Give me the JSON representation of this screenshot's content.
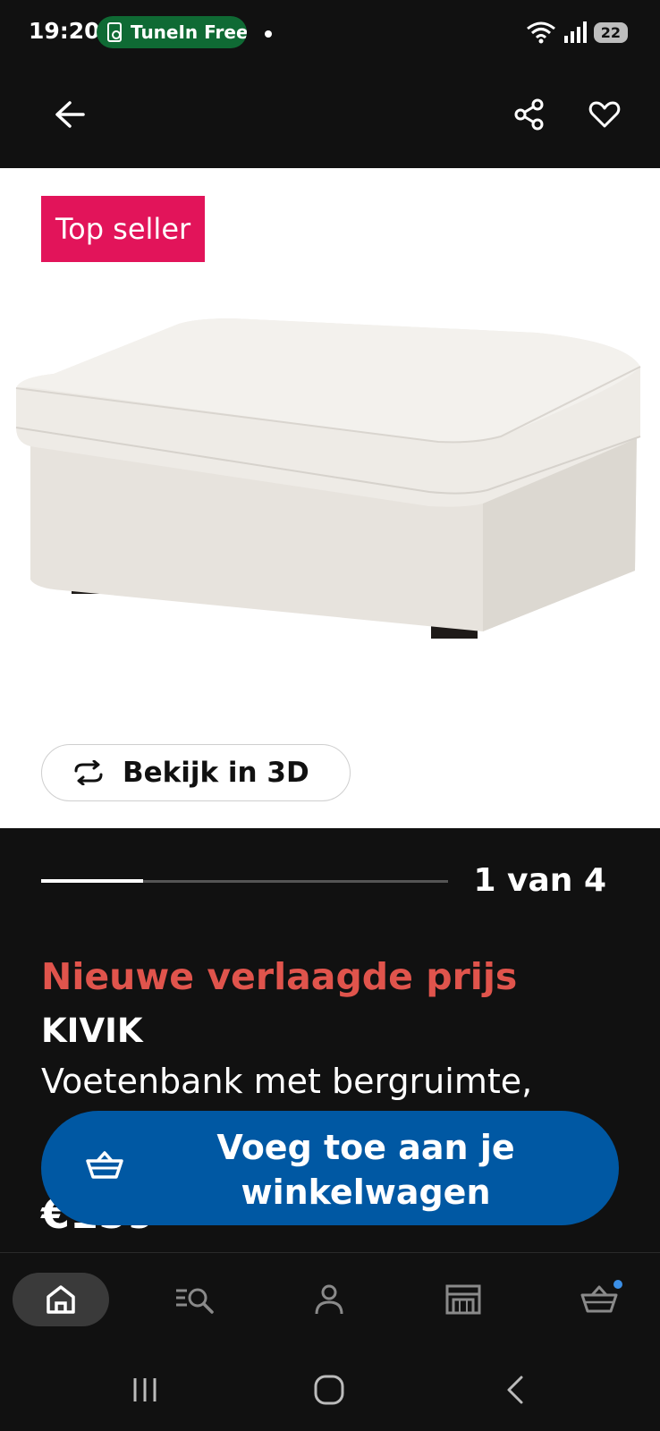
{
  "status_bar": {
    "time": "19:20",
    "notification_app": "TuneIn Free",
    "battery": "22"
  },
  "header": {
    "back_icon": "arrow-left-icon",
    "share_icon": "share-icon",
    "favorite_icon": "heart-icon"
  },
  "product_image": {
    "badge": "Top seller",
    "view_3d_label": "Bekijk in 3D"
  },
  "carousel": {
    "current": 1,
    "total": 4,
    "indicator_text": "1 van 4"
  },
  "product": {
    "promo": "Nieuwe verlaagde prijs",
    "name": "KIVIK",
    "description": "Voetenbank met bergruimte,",
    "price_peek": "€159"
  },
  "cart_button": {
    "label": "Voeg toe aan je winkelwagen"
  },
  "bottom_nav": {
    "items": [
      "home-icon",
      "search-icon",
      "profile-icon",
      "store-icon",
      "cart-icon"
    ]
  },
  "colors": {
    "badge": "#e2145a",
    "promo": "#e0544c",
    "cart_button": "#0058a3",
    "background": "#111111"
  }
}
